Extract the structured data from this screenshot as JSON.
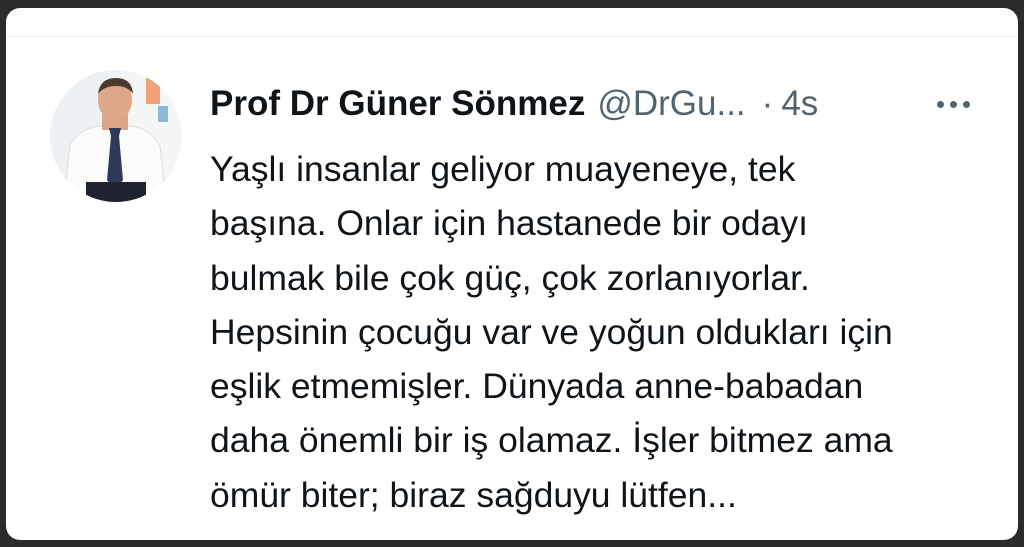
{
  "tweet": {
    "author_name": "Prof Dr Güner Sönmez",
    "author_handle": "@DrGu...",
    "separator": "·",
    "time": "4s",
    "more_icon": "more-horizontal-icon",
    "text_lines": [
      "Yaşlı insanlar geliyor muayeneye, tek",
      "başına. Onlar için hastanede bir odayı",
      "bulmak bile çok güç, çok zorlanıyorlar.",
      "Hepsinin çocuğu var ve yoğun oldukları için",
      "eşlik etmemişler. Dünyada anne-babadan",
      "daha önemli bir iş olamaz. İşler bitmez ama",
      "ömür biter; biraz sağduyu lütfen..."
    ]
  },
  "colors": {
    "text_primary": "#0f1419",
    "text_secondary": "#536471",
    "background": "#ffffff",
    "frame": "#2b2b2b"
  }
}
